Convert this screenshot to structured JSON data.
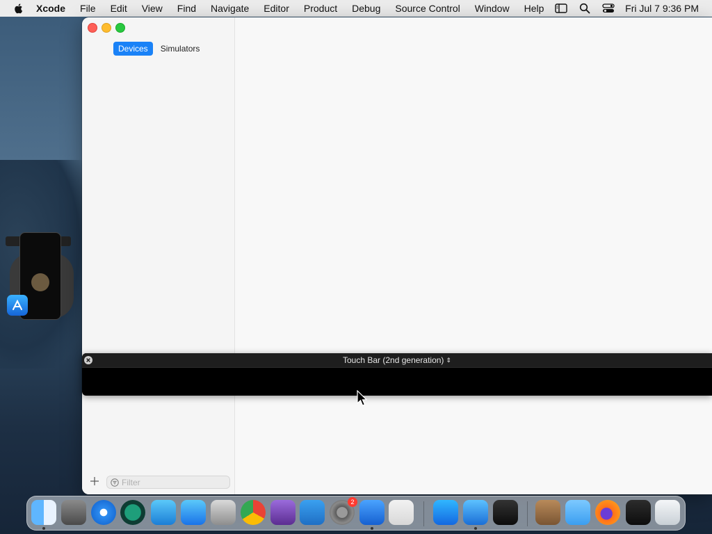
{
  "menubar": {
    "app_name": "Xcode",
    "menus": [
      "File",
      "Edit",
      "View",
      "Find",
      "Navigate",
      "Editor",
      "Product",
      "Debug",
      "Source Control",
      "Window",
      "Help"
    ],
    "clock": "Fri Jul 7  9:36 PM"
  },
  "devices_window": {
    "tabs": [
      {
        "label": "Devices",
        "active": true
      },
      {
        "label": "Simulators",
        "active": false
      }
    ],
    "filter_placeholder": "Filter"
  },
  "touch_bar": {
    "title": "Touch Bar (2nd generation)"
  },
  "dock": {
    "apps": [
      {
        "name": "finder-icon",
        "running": true
      },
      {
        "name": "script-editor-icon",
        "running": false
      },
      {
        "name": "safari-icon",
        "running": false
      },
      {
        "name": "time-machine-icon",
        "running": false
      },
      {
        "name": "testflight-icon",
        "running": false
      },
      {
        "name": "xcode-app-store-icon",
        "running": false
      },
      {
        "name": "system-toolkit-icon",
        "running": false
      },
      {
        "name": "chrome-icon",
        "running": false
      },
      {
        "name": "visual-studio-icon",
        "running": false
      },
      {
        "name": "vscode-icon",
        "running": false
      },
      {
        "name": "system-preferences-icon",
        "running": false,
        "badge": "2"
      },
      {
        "name": "simulator-icon",
        "running": true
      },
      {
        "name": "launchpad-icon",
        "running": false
      },
      {
        "name": "app-store-icon",
        "running": false
      },
      {
        "name": "xcode-icon",
        "running": true
      },
      {
        "name": "console-icon",
        "running": false
      },
      {
        "name": "archive-icon",
        "running": false
      },
      {
        "name": "folder-icon",
        "running": false
      },
      {
        "name": "firefox-icon",
        "running": false
      },
      {
        "name": "activity-monitor-icon",
        "running": false
      },
      {
        "name": "trash-icon",
        "running": false
      }
    ]
  },
  "colors": {
    "accent": "#1a82f7",
    "close": "#fe5f57",
    "minimize": "#febc2e",
    "zoom": "#28c840",
    "badge": "#ff3b30"
  }
}
